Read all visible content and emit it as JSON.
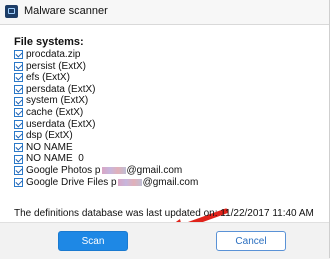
{
  "window": {
    "title": "Malware scanner",
    "icon": "app-icon"
  },
  "file_systems": {
    "title": "File systems:",
    "items": [
      {
        "label": "procdata.zip",
        "checked": true
      },
      {
        "label": "persist (ExtX)",
        "checked": true
      },
      {
        "label": "efs (ExtX)",
        "checked": true
      },
      {
        "label": "persdata (ExtX)",
        "checked": true
      },
      {
        "label": "system (ExtX)",
        "checked": true
      },
      {
        "label": "cache (ExtX)",
        "checked": true
      },
      {
        "label": "userdata (ExtX)",
        "checked": true
      },
      {
        "label": "dsp (ExtX)",
        "checked": true
      },
      {
        "label": "NO NAME",
        "checked": true
      },
      {
        "label": "NO NAME  0",
        "checked": true
      },
      {
        "label_prefix": "Google Photos p",
        "label_suffix": "@gmail.com",
        "checked": true
      },
      {
        "label_prefix": "Google Drive Files p",
        "label_suffix": "@gmail.com",
        "checked": true
      }
    ]
  },
  "status": {
    "text": "The definitions database was last updated on: 11/22/2017 11:40 AM"
  },
  "buttons": {
    "scan": "Scan",
    "cancel": "Cancel"
  },
  "colors": {
    "accent": "#1e88e5",
    "arrow": "#e0231b",
    "checkbox": "#2a79c9"
  }
}
